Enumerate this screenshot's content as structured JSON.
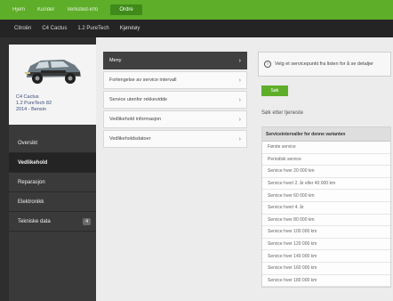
{
  "topbar": {
    "items": [
      "Hjem",
      "Kunder",
      "Verksted-info"
    ],
    "active_tab": "Ordre"
  },
  "subbar": {
    "breadcrumbs": [
      "Citroën",
      "C4 Cactus",
      "1.2 PureTech",
      "Kjøretøy"
    ]
  },
  "vehicle": {
    "name": "C4 Cactus",
    "line1": "1.2 PureTech 82",
    "line2": "2014 - Bensin"
  },
  "sidebar": {
    "items": [
      {
        "label": "Oversikt",
        "active": false
      },
      {
        "label": "Vedlikehold",
        "active": true
      },
      {
        "label": "Reparasjon",
        "active": false
      },
      {
        "label": "Elektronikk",
        "active": false
      },
      {
        "label": "Tekniske data",
        "active": false,
        "badge": "4"
      }
    ]
  },
  "list": {
    "items": [
      {
        "label": "Meny",
        "selected": true
      },
      {
        "label": "Forlengelse av service intervall",
        "selected": false
      },
      {
        "label": "Service utenfor rekkevidde",
        "selected": false
      },
      {
        "label": "Vedlikehold informasjon",
        "selected": false
      },
      {
        "label": "Vedlikeholdsdatoer",
        "selected": false
      }
    ]
  },
  "right": {
    "info_text": "Velg et servicepunkt fra listen for å se detaljer",
    "button_label": "Søk",
    "search_label": "Søk etter tjeneste",
    "table_header": "Serviceintervaller for denne varianten",
    "rows": [
      "Første service",
      "Periodisk service",
      "Service hver 20 000 km",
      "Service hvert 2. år eller 40 000 km",
      "Service hver 60 000 km",
      "Service hvert 4. år",
      "Service hver 80 000 km",
      "Service hver 100 000 km",
      "Service hver 120 000 km",
      "Service hver 140 000 km",
      "Service hver 160 000 km",
      "Service hver 180 000 km"
    ]
  },
  "colors": {
    "brand_green": "#5fae2a",
    "dark": "#242424"
  }
}
